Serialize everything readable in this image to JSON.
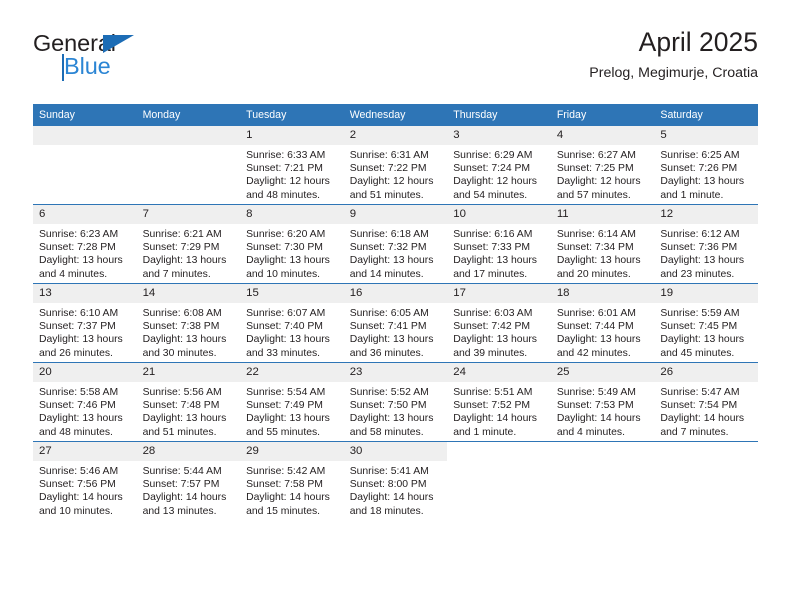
{
  "brand": {
    "name_primary": "General",
    "name_secondary": "Blue",
    "logo_icon": "triangle-flag-icon"
  },
  "header": {
    "title": "April 2025",
    "subtitle": "Prelog, Megimurje, Croatia"
  },
  "calendar": {
    "weekday_headers": [
      "Sunday",
      "Monday",
      "Tuesday",
      "Wednesday",
      "Thursday",
      "Friday",
      "Saturday"
    ],
    "header_bg_color": "#2e75b6",
    "daynum_bg_color": "#efefef",
    "text_color": "#231f20",
    "weeks": [
      [
        {
          "day": "",
          "lines": []
        },
        {
          "day": "",
          "lines": []
        },
        {
          "day": "1",
          "lines": [
            "Sunrise: 6:33 AM",
            "Sunset: 7:21 PM",
            "Daylight: 12 hours",
            "and 48 minutes."
          ]
        },
        {
          "day": "2",
          "lines": [
            "Sunrise: 6:31 AM",
            "Sunset: 7:22 PM",
            "Daylight: 12 hours",
            "and 51 minutes."
          ]
        },
        {
          "day": "3",
          "lines": [
            "Sunrise: 6:29 AM",
            "Sunset: 7:24 PM",
            "Daylight: 12 hours",
            "and 54 minutes."
          ]
        },
        {
          "day": "4",
          "lines": [
            "Sunrise: 6:27 AM",
            "Sunset: 7:25 PM",
            "Daylight: 12 hours",
            "and 57 minutes."
          ]
        },
        {
          "day": "5",
          "lines": [
            "Sunrise: 6:25 AM",
            "Sunset: 7:26 PM",
            "Daylight: 13 hours",
            "and 1 minute."
          ]
        }
      ],
      [
        {
          "day": "6",
          "lines": [
            "Sunrise: 6:23 AM",
            "Sunset: 7:28 PM",
            "Daylight: 13 hours",
            "and 4 minutes."
          ]
        },
        {
          "day": "7",
          "lines": [
            "Sunrise: 6:21 AM",
            "Sunset: 7:29 PM",
            "Daylight: 13 hours",
            "and 7 minutes."
          ]
        },
        {
          "day": "8",
          "lines": [
            "Sunrise: 6:20 AM",
            "Sunset: 7:30 PM",
            "Daylight: 13 hours",
            "and 10 minutes."
          ]
        },
        {
          "day": "9",
          "lines": [
            "Sunrise: 6:18 AM",
            "Sunset: 7:32 PM",
            "Daylight: 13 hours",
            "and 14 minutes."
          ]
        },
        {
          "day": "10",
          "lines": [
            "Sunrise: 6:16 AM",
            "Sunset: 7:33 PM",
            "Daylight: 13 hours",
            "and 17 minutes."
          ]
        },
        {
          "day": "11",
          "lines": [
            "Sunrise: 6:14 AM",
            "Sunset: 7:34 PM",
            "Daylight: 13 hours",
            "and 20 minutes."
          ]
        },
        {
          "day": "12",
          "lines": [
            "Sunrise: 6:12 AM",
            "Sunset: 7:36 PM",
            "Daylight: 13 hours",
            "and 23 minutes."
          ]
        }
      ],
      [
        {
          "day": "13",
          "lines": [
            "Sunrise: 6:10 AM",
            "Sunset: 7:37 PM",
            "Daylight: 13 hours",
            "and 26 minutes."
          ]
        },
        {
          "day": "14",
          "lines": [
            "Sunrise: 6:08 AM",
            "Sunset: 7:38 PM",
            "Daylight: 13 hours",
            "and 30 minutes."
          ]
        },
        {
          "day": "15",
          "lines": [
            "Sunrise: 6:07 AM",
            "Sunset: 7:40 PM",
            "Daylight: 13 hours",
            "and 33 minutes."
          ]
        },
        {
          "day": "16",
          "lines": [
            "Sunrise: 6:05 AM",
            "Sunset: 7:41 PM",
            "Daylight: 13 hours",
            "and 36 minutes."
          ]
        },
        {
          "day": "17",
          "lines": [
            "Sunrise: 6:03 AM",
            "Sunset: 7:42 PM",
            "Daylight: 13 hours",
            "and 39 minutes."
          ]
        },
        {
          "day": "18",
          "lines": [
            "Sunrise: 6:01 AM",
            "Sunset: 7:44 PM",
            "Daylight: 13 hours",
            "and 42 minutes."
          ]
        },
        {
          "day": "19",
          "lines": [
            "Sunrise: 5:59 AM",
            "Sunset: 7:45 PM",
            "Daylight: 13 hours",
            "and 45 minutes."
          ]
        }
      ],
      [
        {
          "day": "20",
          "lines": [
            "Sunrise: 5:58 AM",
            "Sunset: 7:46 PM",
            "Daylight: 13 hours",
            "and 48 minutes."
          ]
        },
        {
          "day": "21",
          "lines": [
            "Sunrise: 5:56 AM",
            "Sunset: 7:48 PM",
            "Daylight: 13 hours",
            "and 51 minutes."
          ]
        },
        {
          "day": "22",
          "lines": [
            "Sunrise: 5:54 AM",
            "Sunset: 7:49 PM",
            "Daylight: 13 hours",
            "and 55 minutes."
          ]
        },
        {
          "day": "23",
          "lines": [
            "Sunrise: 5:52 AM",
            "Sunset: 7:50 PM",
            "Daylight: 13 hours",
            "and 58 minutes."
          ]
        },
        {
          "day": "24",
          "lines": [
            "Sunrise: 5:51 AM",
            "Sunset: 7:52 PM",
            "Daylight: 14 hours",
            "and 1 minute."
          ]
        },
        {
          "day": "25",
          "lines": [
            "Sunrise: 5:49 AM",
            "Sunset: 7:53 PM",
            "Daylight: 14 hours",
            "and 4 minutes."
          ]
        },
        {
          "day": "26",
          "lines": [
            "Sunrise: 5:47 AM",
            "Sunset: 7:54 PM",
            "Daylight: 14 hours",
            "and 7 minutes."
          ]
        }
      ],
      [
        {
          "day": "27",
          "lines": [
            "Sunrise: 5:46 AM",
            "Sunset: 7:56 PM",
            "Daylight: 14 hours",
            "and 10 minutes."
          ]
        },
        {
          "day": "28",
          "lines": [
            "Sunrise: 5:44 AM",
            "Sunset: 7:57 PM",
            "Daylight: 14 hours",
            "and 13 minutes."
          ]
        },
        {
          "day": "29",
          "lines": [
            "Sunrise: 5:42 AM",
            "Sunset: 7:58 PM",
            "Daylight: 14 hours",
            "and 15 minutes."
          ]
        },
        {
          "day": "30",
          "lines": [
            "Sunrise: 5:41 AM",
            "Sunset: 8:00 PM",
            "Daylight: 14 hours",
            "and 18 minutes."
          ]
        },
        {
          "day": "",
          "lines": []
        },
        {
          "day": "",
          "lines": []
        },
        {
          "day": "",
          "lines": []
        }
      ]
    ]
  }
}
